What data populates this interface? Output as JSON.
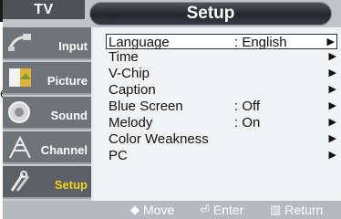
{
  "header": {
    "tab": "TV",
    "title": "Setup"
  },
  "edge_char": "e",
  "sidebar": {
    "items": [
      {
        "label": "Input",
        "icon": "input-plug-icon",
        "active": false
      },
      {
        "label": "Picture",
        "icon": "picture-icon",
        "active": false
      },
      {
        "label": "Sound",
        "icon": "sound-speaker-icon",
        "active": false
      },
      {
        "label": "Channel",
        "icon": "channel-antenna-icon",
        "active": false
      },
      {
        "label": "Setup",
        "icon": "setup-tools-icon",
        "active": true
      }
    ]
  },
  "menu": {
    "rows": [
      {
        "name": "Language",
        "value": ": English",
        "arrow": "▶",
        "selected": true
      },
      {
        "name": "Time",
        "value": "",
        "arrow": "▶",
        "selected": false
      },
      {
        "name": "V-Chip",
        "value": "",
        "arrow": "▶",
        "selected": false
      },
      {
        "name": "Caption",
        "value": "",
        "arrow": "▶",
        "selected": false
      },
      {
        "name": "Blue Screen",
        "value": ": Off",
        "arrow": "▶",
        "selected": false
      },
      {
        "name": "Melody",
        "value": ": On",
        "arrow": "▶",
        "selected": false
      },
      {
        "name": "Color Weakness",
        "value": "",
        "arrow": "▶",
        "selected": false
      },
      {
        "name": "PC",
        "value": "",
        "arrow": "▶",
        "selected": false
      }
    ]
  },
  "footer": {
    "move_label": "Move",
    "move_glyph": "◆",
    "enter_label": "Enter",
    "enter_glyph": "⏎",
    "return_label": "Return",
    "return_glyph": "▥"
  },
  "colors": {
    "accent_active_label": "#f5d31f",
    "osd_background": "#e9ecef"
  }
}
